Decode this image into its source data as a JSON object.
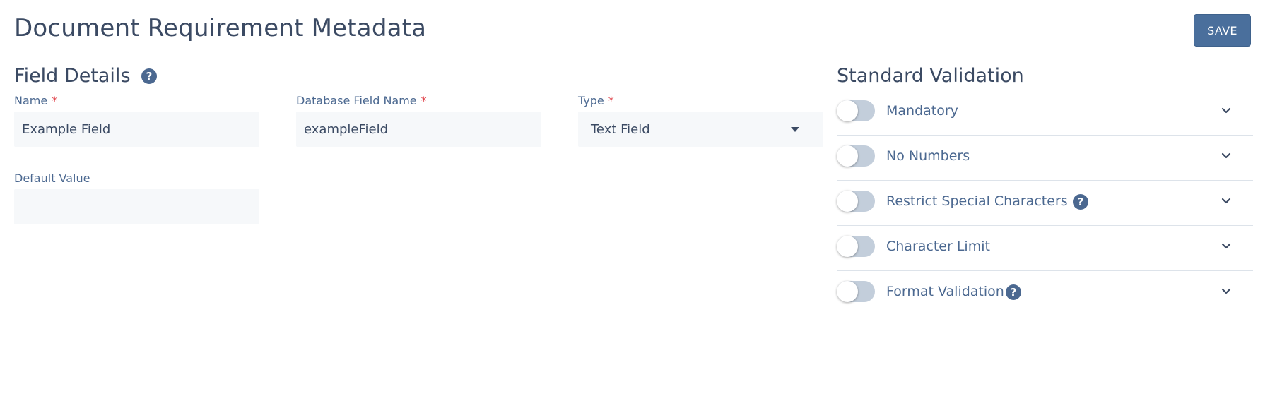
{
  "header": {
    "title": "Document Requirement Metadata",
    "save_label": "SAVE"
  },
  "field_details": {
    "title": "Field Details",
    "help_glyph": "?",
    "name": {
      "label": "Name",
      "required_mark": "*",
      "value": "Example Field"
    },
    "db_field_name": {
      "label": "Database Field Name",
      "required_mark": "*",
      "value": "exampleField"
    },
    "type": {
      "label": "Type",
      "required_mark": "*",
      "value": "Text Field"
    },
    "default_value": {
      "label": "Default Value",
      "value": ""
    }
  },
  "standard_validation": {
    "title": "Standard Validation",
    "items": [
      {
        "label": "Mandatory",
        "enabled": false,
        "has_help": false
      },
      {
        "label": "No Numbers",
        "enabled": false,
        "has_help": false
      },
      {
        "label": "Restrict Special Characters",
        "enabled": false,
        "has_help": true
      },
      {
        "label": "Character Limit",
        "enabled": false,
        "has_help": false
      },
      {
        "label": "Format Validation",
        "enabled": false,
        "has_help": true
      }
    ],
    "help_glyph": "?"
  },
  "colors": {
    "accent": "#4a6f9c",
    "text": "#3b4a63",
    "label": "#4b6890",
    "required": "#e0434b",
    "toggle_off": "#c3cedb"
  }
}
